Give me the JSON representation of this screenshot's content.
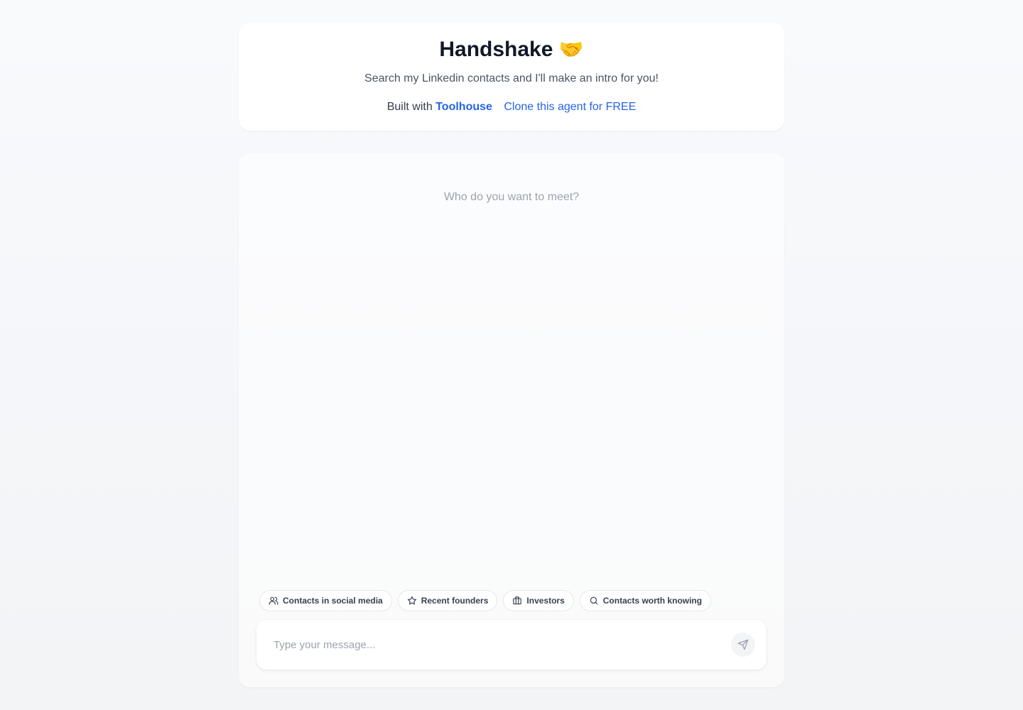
{
  "header": {
    "title": "Handshake",
    "title_emoji": "🤝",
    "subtitle": "Search my Linkedin contacts and I'll make an intro for you!",
    "built_with": "Built with",
    "brand_link": "Toolhouse",
    "clone_link": "Clone this agent for FREE"
  },
  "chat": {
    "empty_prompt": "Who do you want to meet?",
    "suggestions": [
      {
        "label": "Contacts in social media",
        "icon": "users-icon"
      },
      {
        "label": "Recent founders",
        "icon": "star-icon"
      },
      {
        "label": "Investors",
        "icon": "briefcase-icon"
      },
      {
        "label": "Contacts worth knowing",
        "icon": "search-icon"
      }
    ],
    "input": {
      "placeholder": "Type your message...",
      "value": ""
    },
    "send_icon": "send-icon"
  },
  "colors": {
    "accent": "#2563eb",
    "title": "#111827",
    "muted": "#9ca3af"
  }
}
